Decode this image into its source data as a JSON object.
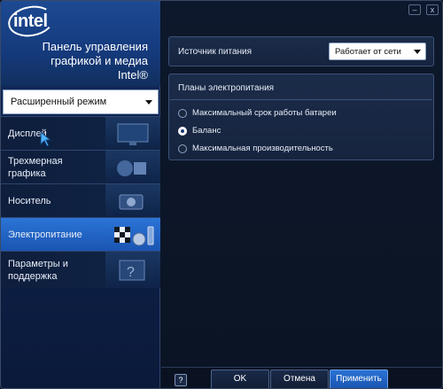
{
  "brand": {
    "logo_text": "intel",
    "title_line1": "Панель управления",
    "title_line2": "графикой и медиа",
    "title_line3": "Intel®"
  },
  "mode_select": {
    "value": "Расширенный режим"
  },
  "nav": [
    {
      "label": "Дисплей",
      "icon": "display-icon",
      "active": false
    },
    {
      "label": "Трехмерная графика",
      "icon": "3d-objects-icon",
      "active": false
    },
    {
      "label": "Носитель",
      "icon": "media-icon",
      "active": false
    },
    {
      "label": "Электропитание",
      "icon": "power-flag-icon",
      "active": true
    },
    {
      "label_line1": "Параметры и",
      "label_line2": "поддержка",
      "icon": "help-question-icon",
      "active": false
    }
  ],
  "power_source": {
    "label": "Источник питания",
    "value": "Работает от сети"
  },
  "plans": {
    "title": "Планы электропитания",
    "options": [
      {
        "label": "Максимальный срок работы батареи",
        "selected": false
      },
      {
        "label": "Баланс",
        "selected": true
      },
      {
        "label": "Максимальная производительность",
        "selected": false
      }
    ]
  },
  "buttons": {
    "help": "?",
    "ok": "OK",
    "cancel": "Отмена",
    "apply": "Применить"
  },
  "window_controls": {
    "minimize": "–",
    "close": "x"
  },
  "colors": {
    "accent": "#1f5fc2",
    "active_item": "#2b74d6"
  }
}
